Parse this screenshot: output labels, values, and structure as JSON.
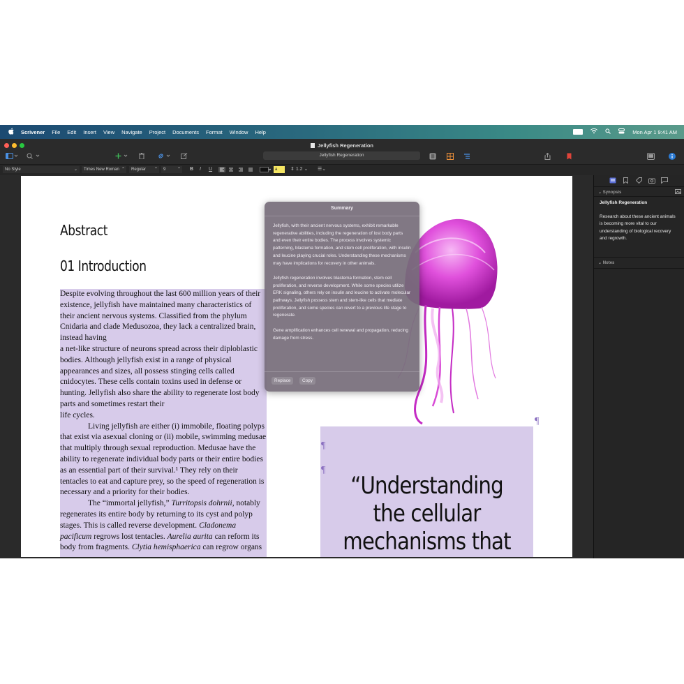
{
  "menubar": {
    "apple": "",
    "app_name": "Scrivener",
    "items": [
      "File",
      "Edit",
      "Insert",
      "View",
      "Navigate",
      "Project",
      "Documents",
      "Format",
      "Window",
      "Help"
    ],
    "datetime": "Mon Apr 1  9:41 AM"
  },
  "window": {
    "title": "Jellyfish Regeneration",
    "document_field": "Jellyfish Regeneration"
  },
  "formatbar": {
    "style": "No Style",
    "font": "Times New Roman",
    "weight": "Regular",
    "size": "9",
    "bold": "B",
    "italic": "I",
    "underline": "U",
    "highlight": "a",
    "line_spacing": "1.2"
  },
  "document": {
    "abstract_heading": "Abstract",
    "intro_heading": "01 Introduction",
    "paragraphs": [
      "Despite evolving throughout the last 600 million years of their existence, jellyfish have maintained many characteristics of their ancient nervous systems. Classified from the phylum Cnidaria and clade Medusozoa, they lack a centralized brain, instead having",
      "a net-like structure of neurons spread across their diploblastic bodies. Although jellyfish exist in a range of physical appearances and sizes, all possess stinging cells called cnidocytes. These cells contain toxins used in defense or hunting. Jellyfish also share the ability to regenerate lost body parts and sometimes restart their",
      "life cycles.",
      "Living jellyfish are either (i) immobile, floating polyps that exist via asexual cloning or (ii) mobile, swimming medusae that multiply through sexual reproduction. Medusae have the ability to regenerate individual body parts or their entire bodies as an essential part of their survival.¹ They rely on their tentacles to eat and capture prey, so the speed of regeneration is necessary and a priority for their bodies."
    ],
    "para5": {
      "t1": "The “immortal jellyfish,” ",
      "i1": "Turritopsis dohrnii",
      "t2": ", notably regenerates its entire body by returning to its cyst and polyp stages. This is called reverse development. ",
      "i2": "Cladonema pacificum",
      "t3": " regrows lost tentacles. ",
      "i3": "Aurelia aurita",
      "t4": " can reform its body from fragments. ",
      "i4": "Clytia hemisphaerica",
      "t5": " can regrow organs"
    },
    "pilcrow": "¶",
    "pull_quote": "“Understanding the cellular mechanisms that lead to jellyfish"
  },
  "summary": {
    "title": "Summary",
    "paragraphs": [
      "Jellyfish, with their ancient nervous systems, exhibit remarkable regenerative abilities, including the regeneration of lost body parts and even their entire bodies. The process involves systemic patterning, blastema formation, and stem cell proliferation, with insulin and leucine playing crucial roles. Understanding these mechanisms may have implications for recovery in other animals.",
      "Jellyfish regeneration involves blastema formation, stem cell proliferation, and reverse development. While some species utilize ERK signaling, others rely on insulin and leucine to activate molecular pathways. Jellyfish possess stem and stem-like cells that mediate proliferation, and some species can revert to a previous life stage to regenerate.",
      "Gene amplification enhances cell renewal and propagation, reducing damage from stress."
    ],
    "replace_label": "Replace",
    "copy_label": "Copy"
  },
  "inspector": {
    "synopsis_label": "Synopsis",
    "synopsis_title": "Jellyfish Regeneration",
    "synopsis_text": "Research about these ancient animals is becoming more vital to our understanding of biological recovery and regrowth.",
    "notes_label": "Notes"
  },
  "colors": {
    "selection": "#d7cbea",
    "jellyfish": "#d62fd2",
    "bookmark": "#e0443a",
    "info": "#2a7bd6"
  }
}
